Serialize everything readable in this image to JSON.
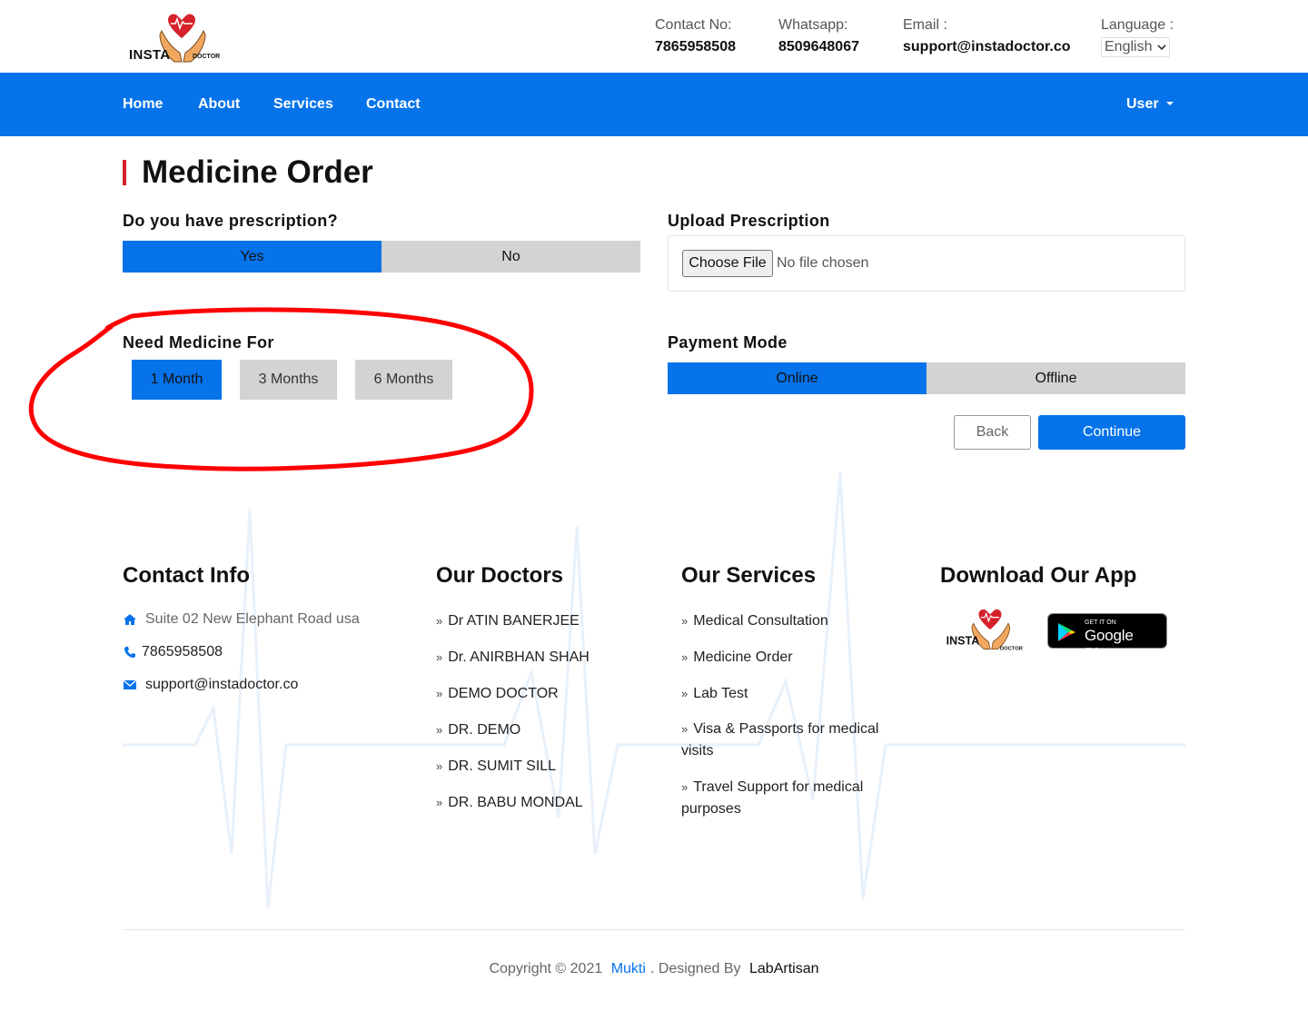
{
  "header": {
    "logo_text": "INSTA",
    "logo_sub": "DOCTOR",
    "contact_label": "Contact No:",
    "contact_value": "7865958508",
    "whatsapp_label": "Whatsapp:",
    "whatsapp_value": "8509648067",
    "email_label": "Email :",
    "email_value": "support@instadoctor.co",
    "language_label": "Language :",
    "language_value": "English"
  },
  "nav": {
    "items": [
      "Home",
      "About",
      "Services",
      "Contact"
    ],
    "user_label": "User"
  },
  "page": {
    "title": "Medicine Order",
    "prescription_question": "Do you have prescription?",
    "prescription_options": [
      "Yes",
      "No"
    ],
    "prescription_selected": "Yes",
    "upload_label": "Upload Prescription",
    "choose_file_label": "Choose File",
    "no_file_text": "No file chosen",
    "need_for_label": "Need Medicine For",
    "durations": [
      "1 Month",
      "3 Months",
      "6 Months"
    ],
    "duration_selected": "1 Month",
    "payment_label": "Payment Mode",
    "payment_options": [
      "Online",
      "Offline"
    ],
    "payment_selected": "Online",
    "back_label": "Back",
    "continue_label": "Continue"
  },
  "footer": {
    "contact_heading": "Contact Info",
    "address": "Suite 02 New Elephant Road usa",
    "phone": "7865958508",
    "email": "support@instadoctor.co",
    "doctors_heading": "Our Doctors",
    "doctors": [
      "Dr ATIN BANERJEE",
      "Dr. ANIRBHAN SHAH",
      "DEMO DOCTOR",
      "DR. DEMO",
      "DR. SUMIT SILL",
      "DR. BABU MONDAL"
    ],
    "services_heading": "Our Services",
    "services": [
      "Medical Consultation",
      "Medicine Order",
      "Lab Test",
      "Visa & Passports for medical visits",
      "Travel Support for medical purposes"
    ],
    "app_heading": "Download Our App",
    "gplay_small": "GET IT ON",
    "gplay_big": "Google Play",
    "copyright_prefix": "Copyright © 2021",
    "brand": "Mukti",
    "designed_by": ". Designed By",
    "designer": "LabArtisan"
  },
  "colors": {
    "primary": "#0673ea",
    "accent_red": "#d5222a",
    "inactive": "#d3d3d3",
    "annotation": "#ff0000"
  }
}
